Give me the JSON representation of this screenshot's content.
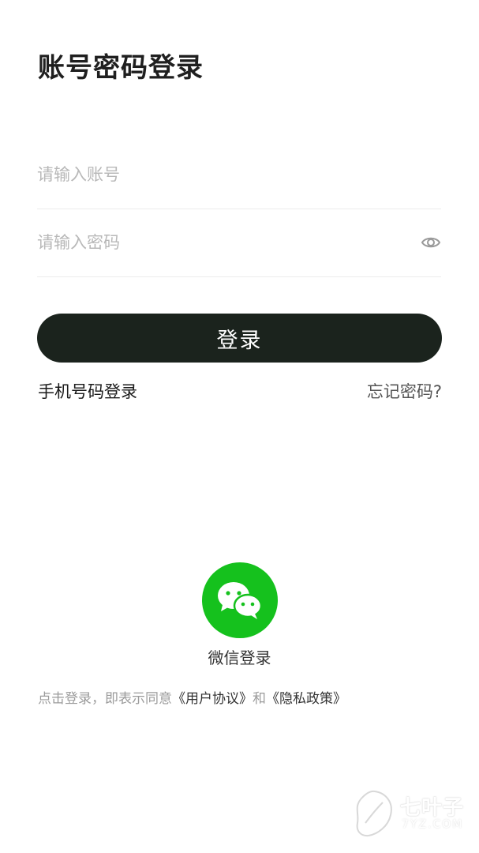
{
  "page": {
    "title": "账号密码登录"
  },
  "form": {
    "account_placeholder": "请输入账号",
    "account_value": "",
    "password_placeholder": "请输入密码",
    "password_value": "",
    "password_toggle_icon": "eye-icon",
    "login_button_label": "登录"
  },
  "links": {
    "phone_login": "手机号码登录",
    "forgot_password": "忘记密码?"
  },
  "wechat": {
    "icon": "wechat-icon",
    "label": "微信登录",
    "color": "#15c11d"
  },
  "agreement": {
    "prefix": "点击登录，即表示同意",
    "user_agreement": "《用户协议》",
    "conjunction": "和",
    "privacy_policy": "《隐私政策》"
  },
  "watermark": {
    "text": "七叶子",
    "sub": "7YZ.COM"
  },
  "colors": {
    "login_button_bg": "#1b231d",
    "placeholder": "#b8b8b8"
  }
}
